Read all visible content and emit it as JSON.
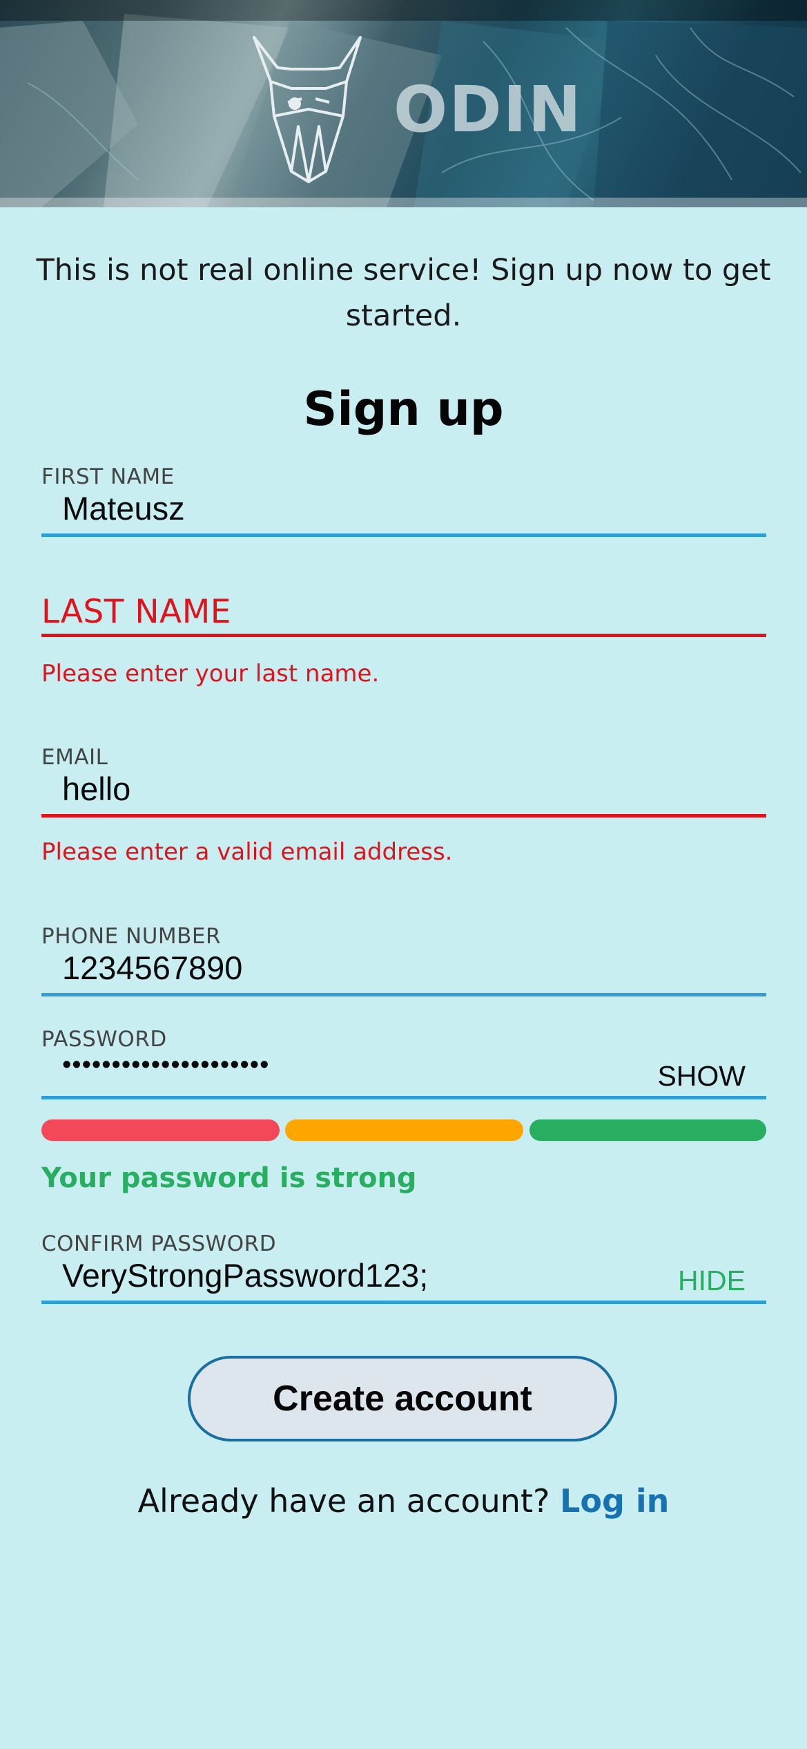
{
  "header": {
    "brand": "ODIN",
    "logo_icon": "viking-head-icon"
  },
  "intro": "This is not real online service! Sign up now to get started.",
  "title": "Sign up",
  "form": {
    "first_name": {
      "label": "FIRST NAME",
      "value": "Mateusz"
    },
    "last_name": {
      "label": "LAST NAME",
      "value": "",
      "error": "Please enter your last name."
    },
    "email": {
      "label": "EMAIL",
      "value": "hello",
      "error": "Please enter a valid email address."
    },
    "phone": {
      "label": "PHONE NUMBER",
      "value": "1234567890"
    },
    "password": {
      "label": "PASSWORD",
      "value": "•••••••••••••••••••••",
      "toggle": "SHOW"
    },
    "strength": {
      "message": "Your password is strong",
      "level": 3,
      "max_level": 3
    },
    "confirm_password": {
      "label": "CONFIRM PASSWORD",
      "value": "VeryStrongPassword123;",
      "toggle": "HIDE"
    }
  },
  "submit_label": "Create account",
  "login_prompt": {
    "text": "Already have an account?",
    "link": "Log in"
  },
  "colors": {
    "background": "#c9eef1",
    "accent": "#2d9fd6",
    "error": "#e0131c",
    "strength_weak": "#f2485a",
    "strength_medium": "#ffa500",
    "strength_strong": "#27ae60",
    "link": "#1672b0"
  }
}
